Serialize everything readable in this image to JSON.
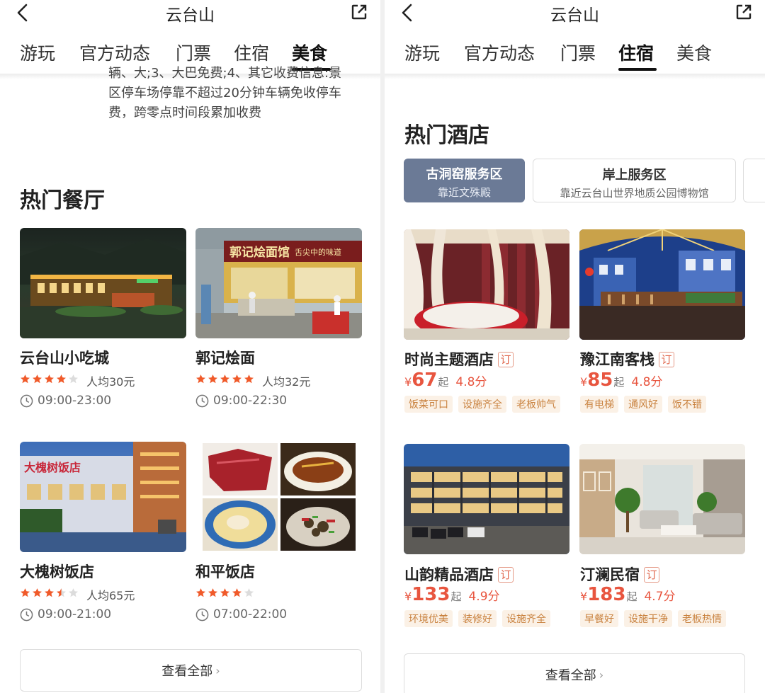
{
  "left": {
    "header": {
      "title": "云台山"
    },
    "tabs": [
      {
        "label": "游玩"
      },
      {
        "label": "官方动态"
      },
      {
        "label": "门票"
      },
      {
        "label": "住宿"
      },
      {
        "label": "美食"
      }
    ],
    "active_tab": "美食",
    "prev_text": {
      "line1": "辆、大;3、大巴免费;4、其它收费信息:景",
      "line2": "区停车场停靠不超过20分钟车辆免收停车",
      "line3": "费，跨零点时间段累加收费"
    },
    "section_title": "热门餐厅",
    "restaurants": [
      {
        "name": "云台山小吃城",
        "rating": 4,
        "avg_price": "人均30元",
        "hours": "09:00-23:00"
      },
      {
        "name": "郭记烩面",
        "rating": 5,
        "avg_price": "人均32元",
        "hours": "09:00-22:30"
      },
      {
        "name": "大槐树饭店",
        "rating": 3.5,
        "avg_price": "人均65元",
        "hours": "09:00-21:00"
      },
      {
        "name": "和平饭店",
        "rating": 4,
        "avg_price": "",
        "hours": "07:00-22:00"
      }
    ],
    "image_text": {
      "guoji_sign": "郭记烩面馆",
      "guoji_slogan": "舌尖中的味道",
      "dahuaishu_sign": "大槐树饭店"
    },
    "view_all": "查看全部"
  },
  "right": {
    "header": {
      "title": "云台山"
    },
    "tabs": [
      {
        "label": "游玩"
      },
      {
        "label": "官方动态"
      },
      {
        "label": "门票"
      },
      {
        "label": "住宿"
      },
      {
        "label": "美食"
      }
    ],
    "active_tab": "住宿",
    "section_title": "热门酒店",
    "areas": [
      {
        "name": "古洞窑服务区",
        "sub": "靠近文殊殿",
        "active": true
      },
      {
        "name": "岸上服务区",
        "sub": "靠近云台山世界地质公园博物馆",
        "active": false
      }
    ],
    "hotels": [
      {
        "name": "时尚主题酒店",
        "book": "订",
        "yen": "¥",
        "price": "67",
        "qi": "起",
        "score": "4.8分",
        "tags": [
          "饭菜可口",
          "设施齐全",
          "老板帅气"
        ]
      },
      {
        "name": "豫江南客栈",
        "book": "订",
        "yen": "¥",
        "price": "85",
        "qi": "起",
        "score": "4.8分",
        "tags": [
          "有电梯",
          "通风好",
          "饭不错"
        ]
      },
      {
        "name": "山韵精品酒店",
        "book": "订",
        "yen": "¥",
        "price": "133",
        "qi": "起",
        "score": "4.9分",
        "tags": [
          "环境优美",
          "装修好",
          "设施齐全"
        ]
      },
      {
        "name": "汀澜民宿",
        "book": "订",
        "yen": "¥",
        "price": "183",
        "qi": "起",
        "score": "4.7分",
        "tags": [
          "早餐好",
          "设施干净",
          "老板热情"
        ]
      }
    ],
    "view_all": "查看全部"
  },
  "colors": {
    "star": "#f05a2a",
    "price": "#e8553f",
    "tag_bg": "#fbf1e6",
    "tag_text": "#c9823f",
    "active_chip": "#6b7a96"
  },
  "icons": [
    "back-arrow-icon",
    "share-icon",
    "star-icon",
    "clock-icon",
    "chevron-right-icon"
  ]
}
